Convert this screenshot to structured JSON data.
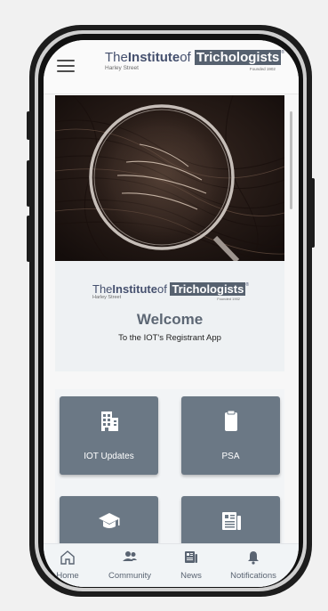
{
  "header": {
    "logo": {
      "the": "The",
      "institute": "Institute",
      "of": "of",
      "trichologists": "Trichologists",
      "registered": "®",
      "subtitle": "Harley Street",
      "founded": "Founded 1902"
    }
  },
  "welcome": {
    "title": "Welcome",
    "subtitle": "To the IOT's Registrant App"
  },
  "tiles": [
    {
      "label": "IOT Updates",
      "icon": "building-icon"
    },
    {
      "label": "PSA",
      "icon": "clipboard-icon"
    },
    {
      "label": "",
      "icon": "graduation-cap-icon"
    },
    {
      "label": "",
      "icon": "newspaper-icon"
    }
  ],
  "tabs": [
    {
      "label": "Home",
      "icon": "home-icon"
    },
    {
      "label": "Community",
      "icon": "users-icon"
    },
    {
      "label": "News",
      "icon": "newspaper-icon"
    },
    {
      "label": "Notifications",
      "icon": "bell-icon"
    }
  ],
  "colors": {
    "tile": "#6b7885",
    "brand_navy": "#45506e",
    "welcome_title": "#5d6774",
    "tab_text": "#5a6472"
  }
}
